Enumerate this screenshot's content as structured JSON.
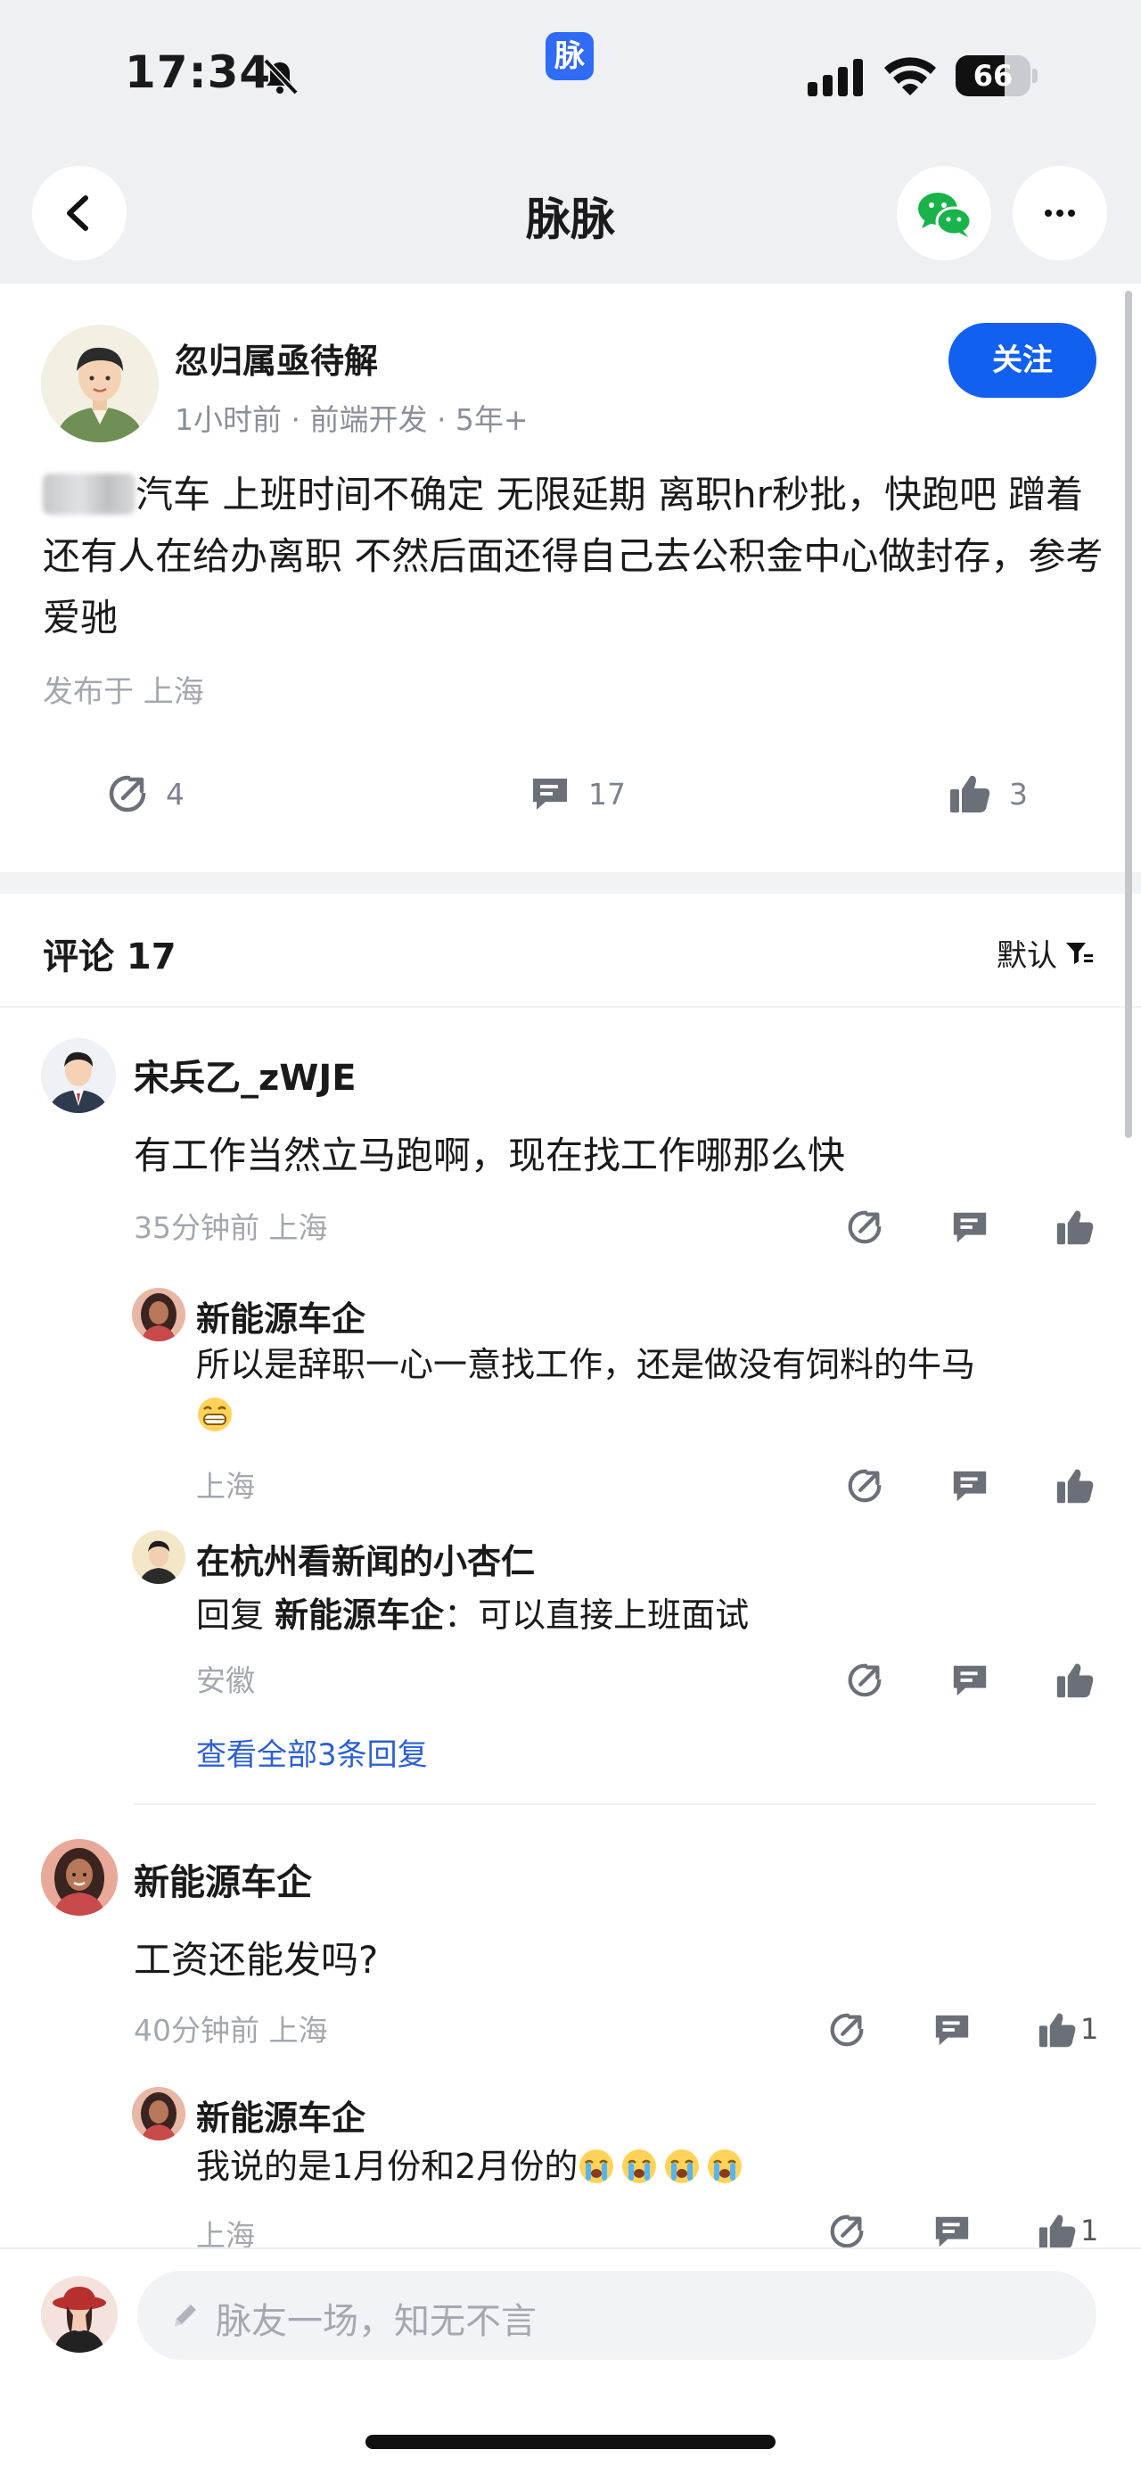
{
  "status_bar": {
    "time": "17:34",
    "battery": "66",
    "battery_level": 0.66,
    "app_badge": "脉"
  },
  "nav": {
    "title": "脉脉"
  },
  "post": {
    "author": "忽归属亟待解",
    "meta": "1小时前 · 前端开发 · 5年+",
    "follow_label": "关注",
    "body_text": "汽车 上班时间不确定 无限延期 离职hr秒批，快跑吧 蹭着还有人在给办离职 不然后面还得自己去公积金中心做封存，参考爱驰",
    "location": "发布于 上海",
    "repost_count": "4",
    "comment_count": "17",
    "like_count": "3"
  },
  "comments_header": {
    "title": "评论 17",
    "sort_label": "默认"
  },
  "comments": [
    {
      "name": "宋兵乙_zWJE",
      "text": "有工作当然立马跑啊，现在找工作哪那么快",
      "meta": "35分钟前  上海",
      "replies": [
        {
          "name": "新能源车企",
          "text": "所以是辞职一心一意找工作，还是做没有饲料的牛马",
          "meta": "上海"
        },
        {
          "name": "在杭州看新闻的小杏仁",
          "reply_prefix": "回复 ",
          "reply_to": "新能源车企",
          "reply_sep": "：",
          "text": "可以直接上班面试",
          "meta": "安徽"
        }
      ],
      "view_all": "查看全部3条回复"
    },
    {
      "name": "新能源车企",
      "text": "工资还能发吗?",
      "meta": "40分钟前  上海",
      "like_count": "1",
      "replies": [
        {
          "name": "新能源车企",
          "text": "我说的是1月份和2月份的",
          "meta": "上海",
          "like_count": "1"
        }
      ]
    }
  ],
  "input": {
    "placeholder": "脉友一场，知无不言"
  },
  "colors": {
    "accent": "#1160f0",
    "link": "#2c5fd6",
    "meta": "#a3a7ae"
  },
  "icons": [
    "back-arrow-icon",
    "wechat-icon",
    "more-icon",
    "repost-icon",
    "comment-icon",
    "thumbs-up-icon",
    "filter-icon",
    "pencil-icon",
    "crying-emoji-icon",
    "grin-emoji-icon"
  ]
}
